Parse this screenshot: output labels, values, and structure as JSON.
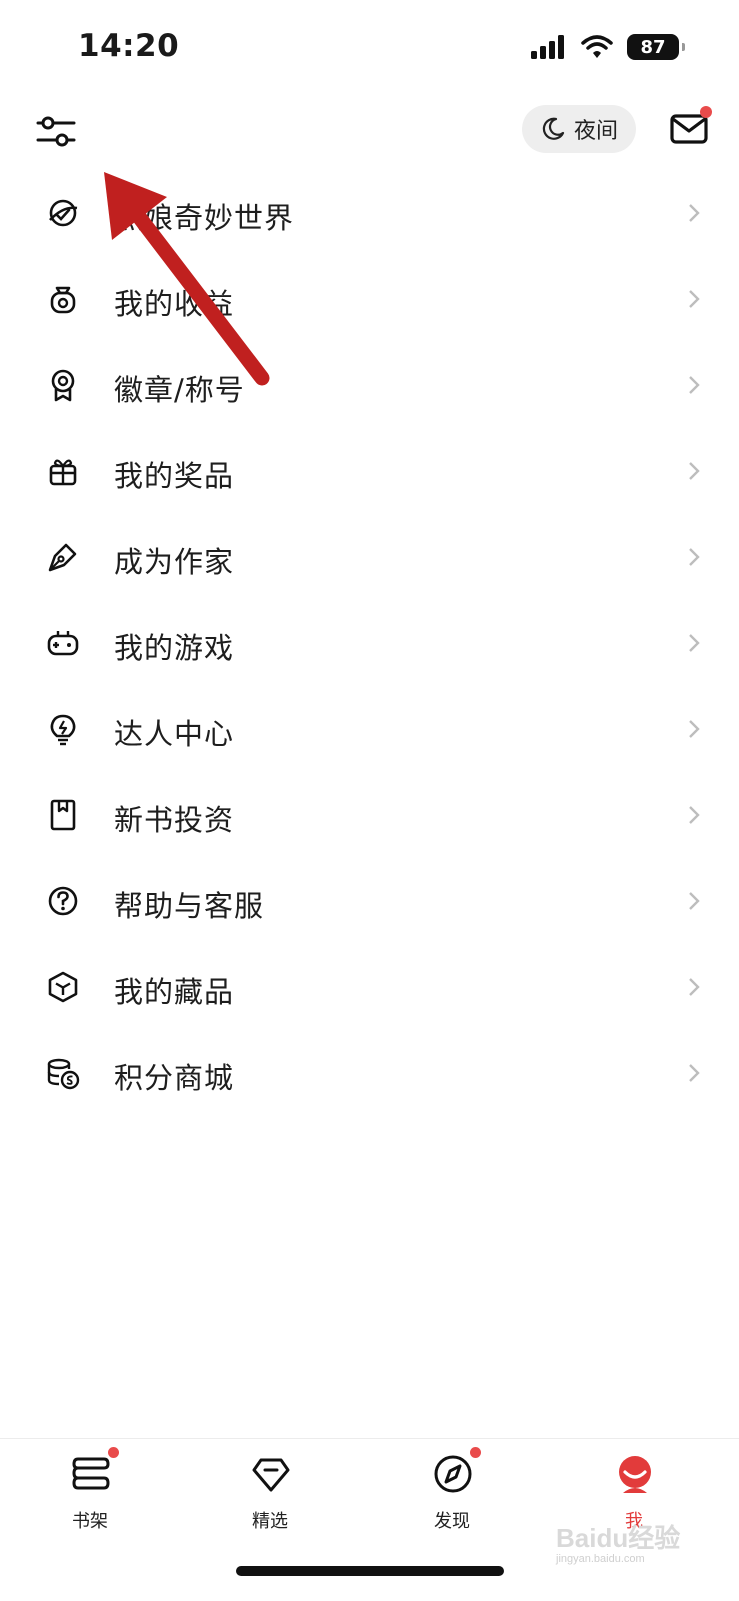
{
  "status_bar": {
    "time": "14:20",
    "battery": "87"
  },
  "topbar": {
    "night_label": "夜间"
  },
  "menu": [
    {
      "label": "点娘奇妙世界",
      "icon": "globe-icon"
    },
    {
      "label": "我的收益",
      "icon": "money-bag-icon"
    },
    {
      "label": "徽章/称号",
      "icon": "badge-medal-icon"
    },
    {
      "label": "我的奖品",
      "icon": "gift-icon"
    },
    {
      "label": "成为作家",
      "icon": "pen-nib-icon"
    },
    {
      "label": "我的游戏",
      "icon": "gamepad-icon"
    },
    {
      "label": "达人中心",
      "icon": "lightbulb-bolt-icon"
    },
    {
      "label": "新书投资",
      "icon": "book-bookmark-icon"
    },
    {
      "label": "帮助与客服",
      "icon": "help-circle-icon"
    },
    {
      "label": "我的藏品",
      "icon": "cube-icon"
    },
    {
      "label": "积分商城",
      "icon": "coins-icon"
    }
  ],
  "bottom_nav": [
    {
      "label": "书架",
      "icon": "bookshelf-icon",
      "badge": true
    },
    {
      "label": "精选",
      "icon": "diamond-icon",
      "badge": false
    },
    {
      "label": "发现",
      "icon": "compass-icon",
      "badge": true
    },
    {
      "label": "我",
      "icon": "profile-face-icon",
      "badge": false,
      "active": true
    }
  ],
  "colors": {
    "accent": "#e23b3b",
    "annotation_arrow": "#c0201f",
    "badge": "#e94b4b"
  },
  "watermark": {
    "main": "Baidu经验",
    "sub": "jingyan.baidu.com"
  }
}
